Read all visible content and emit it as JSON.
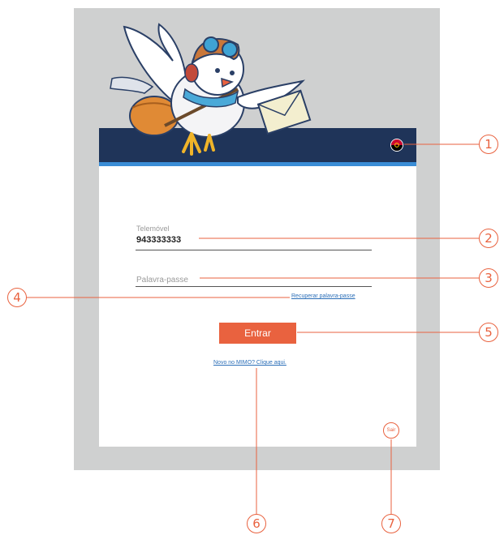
{
  "login": {
    "phone_label": "Telemóvel",
    "phone_value": "943333333",
    "password_placeholder": "Palavra-passe",
    "recover_link": "Recuperar palavra-passe",
    "enter_button": "Entrar",
    "signup_link": "Novo no MIMO? Clique aqui.",
    "exit_button": "Sair"
  },
  "icons": {
    "mascot": "mascot-pigeon-icon",
    "flag": "angola-flag-icon"
  },
  "colors": {
    "header": "#1f3459",
    "header_stripe": "#3a8dd6",
    "accent": "#e9623f",
    "link": "#2c6fb8",
    "frame": "#cfd0d0"
  },
  "callouts": [
    {
      "number": "1",
      "target": "language-flag"
    },
    {
      "number": "2",
      "target": "phone-field"
    },
    {
      "number": "3",
      "target": "password-field"
    },
    {
      "number": "4",
      "target": "recover-password-link"
    },
    {
      "number": "5",
      "target": "enter-button"
    },
    {
      "number": "6",
      "target": "signup-link"
    },
    {
      "number": "7",
      "target": "exit-button"
    }
  ]
}
